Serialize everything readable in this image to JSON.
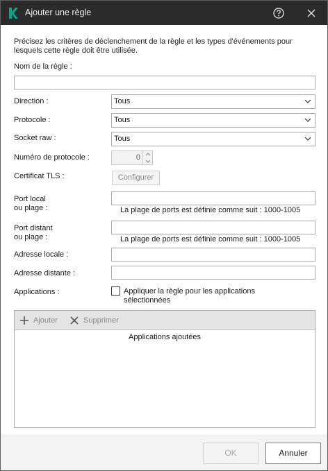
{
  "window": {
    "title": "Ajouter une règle",
    "icons": {
      "app": "kaspersky-logo",
      "help": "help-circle-icon",
      "close": "close-icon"
    },
    "colors": {
      "titlebar": "#2b2b2b",
      "logo": "#00a88e"
    }
  },
  "intro": "Précisez les critères de déclenchement de la règle et les types d'événements pour lesquels cette règle doit être utilisée.",
  "form": {
    "rule_name_label": "Nom de la règle :",
    "rule_name_value": "",
    "direction_label": "Direction :",
    "direction_value": "Tous",
    "protocol_label": "Protocole :",
    "protocol_value": "Tous",
    "socket_label": "Socket raw :",
    "socket_value": "Tous",
    "protocol_number_label": "Numéro de protocole :",
    "protocol_number_value": "0",
    "tls_label": "Certificat TLS :",
    "configure_button": "Configurer",
    "local_port_label_1": "Port local",
    "local_port_label_2": "ou plage :",
    "local_port_value": "",
    "local_port_hint": "La plage de ports est définie comme suit : 1000-1005",
    "remote_port_label_1": "Port distant",
    "remote_port_label_2": "ou plage :",
    "remote_port_value": "",
    "remote_port_hint": "La plage de ports est définie comme suit : 1000-1005",
    "local_address_label": "Adresse locale :",
    "local_address_value": "",
    "remote_address_label": "Adresse distante :",
    "remote_address_value": "",
    "applications_label": "Applications :",
    "apply_checkbox_label": "Appliquer la règle pour les applications sélectionnées",
    "apply_checkbox_checked": false
  },
  "apps": {
    "add_label": "Ajouter",
    "remove_label": "Supprimer",
    "list_header": "Applications ajoutées",
    "items": []
  },
  "footer": {
    "ok_label": "OK",
    "cancel_label": "Annuler"
  }
}
